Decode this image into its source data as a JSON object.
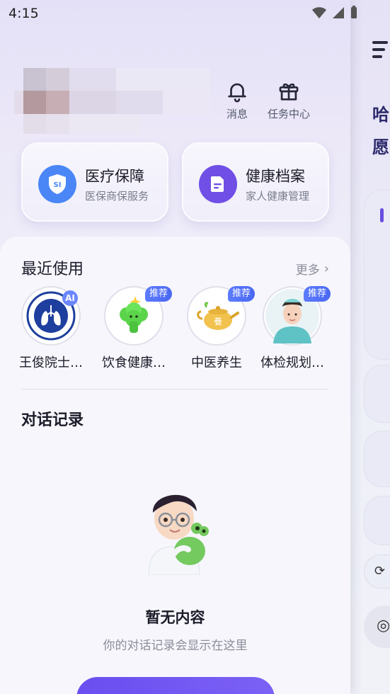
{
  "status": {
    "time": "4:15"
  },
  "top_actions": [
    {
      "label": "消息",
      "icon": "bell-icon"
    },
    {
      "label": "任务中心",
      "icon": "gift-icon"
    }
  ],
  "services": [
    {
      "title": "医疗保障",
      "subtitle": "医保商保服务",
      "icon_text": "SI",
      "color": "#4a86f6"
    },
    {
      "title": "健康档案",
      "subtitle": "家人健康管理",
      "color": "#6f4fe6"
    }
  ],
  "recent": {
    "title": "最近使用",
    "more": "更多",
    "items": [
      {
        "name": "王俊院士…",
        "badge": "AI"
      },
      {
        "name": "饮食健康…",
        "badge": "推荐"
      },
      {
        "name": "中医养生",
        "badge": "推荐",
        "icon_text": "養"
      },
      {
        "name": "体检规划…",
        "badge": "推荐"
      }
    ]
  },
  "history": {
    "title": "对话记录",
    "empty_title": "暂无内容",
    "empty_subtitle": "你的对话记录会显示在这里"
  },
  "background": {
    "greeting_1": "哈",
    "greeting_2": "愿"
  }
}
